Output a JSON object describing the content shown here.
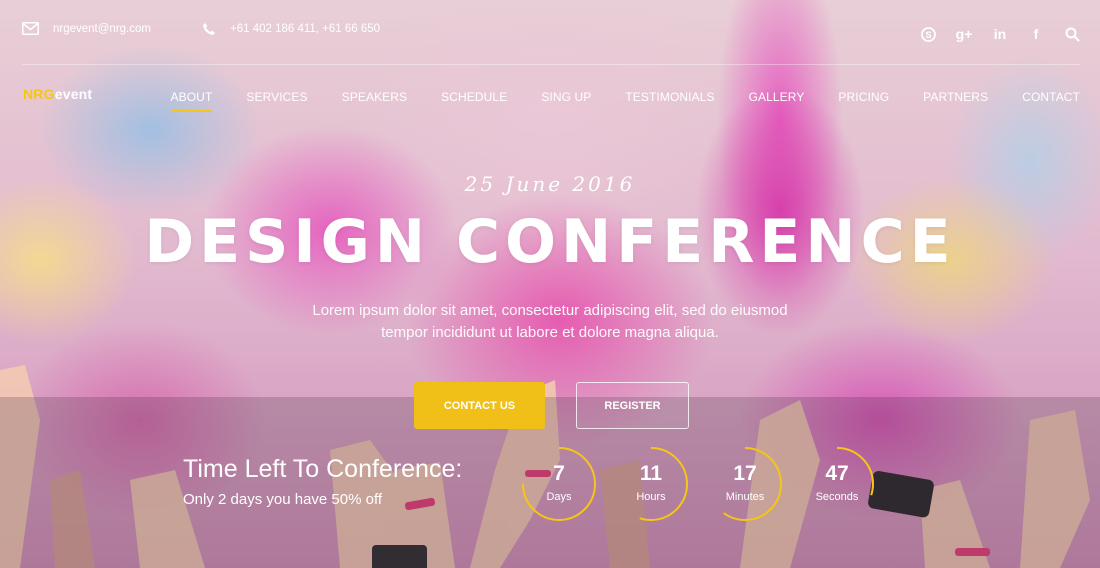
{
  "colors": {
    "accent": "#f5c518",
    "button_yellow": "#f0c018",
    "text": "#ffffff"
  },
  "topbar": {
    "email": "nrgevent@nrg.com",
    "phone": "+61 402 186 411, +61 66 650",
    "email_icon": "envelope-icon",
    "phone_icon": "phone-icon",
    "socials": [
      {
        "icon": "skype-icon",
        "glyph": "S"
      },
      {
        "icon": "google-plus-icon",
        "glyph": "g+"
      },
      {
        "icon": "linkedin-icon",
        "glyph": "in"
      },
      {
        "icon": "facebook-icon",
        "glyph": "f"
      },
      {
        "icon": "search-icon",
        "glyph": ""
      }
    ]
  },
  "logo": {
    "part1": "NRG",
    "part2": "event"
  },
  "nav": {
    "items": [
      {
        "label": "ABOUT",
        "active": true
      },
      {
        "label": "SERVICES",
        "active": false
      },
      {
        "label": "SPEAKERS",
        "active": false
      },
      {
        "label": "SCHEDULE",
        "active": false
      },
      {
        "label": "SING UP",
        "active": false
      },
      {
        "label": "TESTIMONIALS",
        "active": false
      },
      {
        "label": "GALLERY",
        "active": false
      },
      {
        "label": "PRICING",
        "active": false
      },
      {
        "label": "PARTNERS",
        "active": false
      },
      {
        "label": "CONTACT",
        "active": false
      }
    ]
  },
  "hero": {
    "date": "25 June 2016",
    "title": "DESIGN CONFERENCE",
    "subtitle_line1": "Lorem ipsum dolor sit amet, consectetur adipiscing elit, sed do eiusmod",
    "subtitle_line2": "tempor incididunt ut labore et dolore magna aliqua.",
    "contact_button": "CONTACT US",
    "register_button": "REGISTER"
  },
  "countdown": {
    "title": "Time Left To Conference:",
    "subtitle": "Only 2 days you have 50% off",
    "units": [
      {
        "value": "7",
        "label": "Days",
        "progress": 0.75
      },
      {
        "value": "11",
        "label": "Hours",
        "progress": 0.55
      },
      {
        "value": "17",
        "label": "Minutes",
        "progress": 0.6
      },
      {
        "value": "47",
        "label": "Seconds",
        "progress": 0.3
      }
    ]
  }
}
